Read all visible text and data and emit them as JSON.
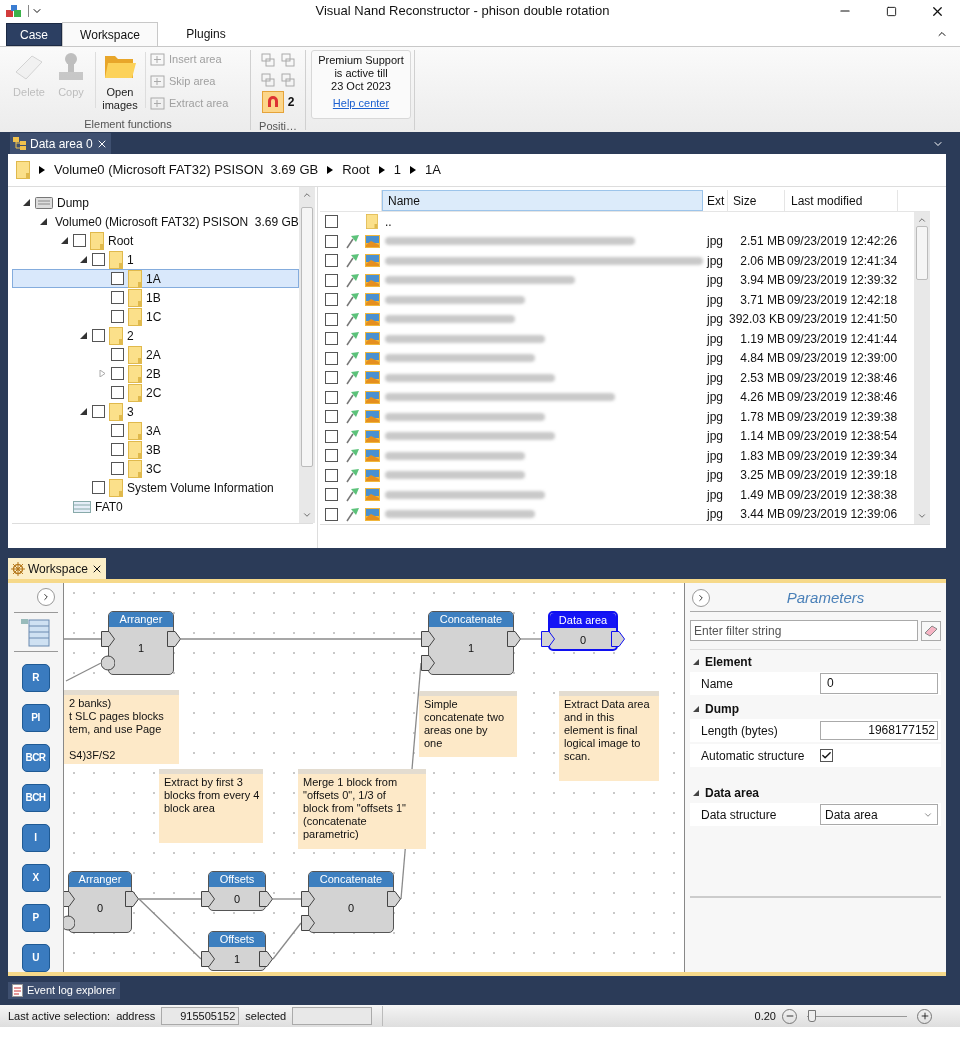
{
  "window": {
    "title": "Visual Nand Reconstructor - phison double rotation"
  },
  "ribbon": {
    "tabs": [
      {
        "label": "Case",
        "kind": "app",
        "selected": false
      },
      {
        "label": "Workspace",
        "kind": "tab",
        "selected": true
      },
      {
        "label": "Plugins",
        "kind": "tab",
        "selected": false
      }
    ],
    "element_functions": {
      "label": "Element functions",
      "large_buttons": [
        {
          "label": "Delete",
          "kind": "eraser",
          "disabled": true
        },
        {
          "label": "Copy",
          "kind": "stamp",
          "disabled": true
        },
        {
          "label": "Open images",
          "kind": "folder",
          "disabled": false
        }
      ],
      "small_buttons": [
        {
          "label": "Insert area",
          "disabled": true
        },
        {
          "label": "Skip area",
          "disabled": true
        },
        {
          "label": "Extract area",
          "disabled": true
        }
      ]
    },
    "position": {
      "label": "Positi…",
      "snap_on": true,
      "count": "2"
    },
    "support": {
      "lines": [
        "Premium Support",
        "is active till",
        "23 Oct 2023"
      ],
      "link": "Help center"
    }
  },
  "data_area_tab": {
    "title": "Data area 0"
  },
  "breadcrumb": [
    "Volume0 (Microsoft FAT32) PSISON  3.69 GB",
    "Root",
    "1",
    "1A"
  ],
  "tree": [
    {
      "label": "Dump",
      "kind": "drive",
      "expanded": true,
      "selected": false,
      "children": [
        {
          "label": "Volume0 (Microsoft FAT32) PSISON  3.69 GB",
          "kind": "disc",
          "expanded": true,
          "selected": false,
          "children": [
            {
              "label": "Root",
              "kind": "folder",
              "expanded": true,
              "checked": false,
              "selected": false,
              "children": [
                {
                  "label": "1",
                  "kind": "folder",
                  "expanded": true,
                  "checked": false,
                  "selected": false,
                  "children": [
                    {
                      "label": "1A",
                      "kind": "folder",
                      "checked": false,
                      "selected": true
                    },
                    {
                      "label": "1B",
                      "kind": "folder",
                      "checked": false,
                      "selected": false
                    },
                    {
                      "label": "1C",
                      "kind": "folder",
                      "checked": false,
                      "selected": false
                    }
                  ]
                },
                {
                  "label": "2",
                  "kind": "folder",
                  "expanded": true,
                  "checked": false,
                  "selected": false,
                  "children": [
                    {
                      "label": "2A",
                      "kind": "folder",
                      "checked": false,
                      "selected": false
                    },
                    {
                      "label": "2B",
                      "kind": "folder",
                      "expanded": false,
                      "checked": false,
                      "selected": false
                    },
                    {
                      "label": "2C",
                      "kind": "folder",
                      "checked": false,
                      "selected": false
                    }
                  ]
                },
                {
                  "label": "3",
                  "kind": "folder",
                  "expanded": true,
                  "checked": false,
                  "selected": false,
                  "children": [
                    {
                      "label": "3A",
                      "kind": "folder",
                      "checked": false,
                      "selected": false
                    },
                    {
                      "label": "3B",
                      "kind": "folder",
                      "checked": false,
                      "selected": false
                    },
                    {
                      "label": "3C",
                      "kind": "folder",
                      "checked": false,
                      "selected": false
                    }
                  ]
                },
                {
                  "label": "System Volume Information",
                  "kind": "folder",
                  "checked": false,
                  "selected": false
                }
              ]
            },
            {
              "label": "FAT0",
              "kind": "table",
              "selected": false
            }
          ]
        }
      ]
    }
  ],
  "files": {
    "columns": [
      "Name",
      "Ext",
      "Size",
      "Last modified"
    ],
    "rows": [
      {
        "kind": "parent",
        "name": "..",
        "checked": false
      },
      {
        "kind": "file",
        "ext": "jpg",
        "size": "2.51 MB",
        "modified": "09/23/2019 12:42:26",
        "checked": false
      },
      {
        "kind": "file",
        "ext": "jpg",
        "size": "2.06 MB",
        "modified": "09/23/2019 12:41:34",
        "checked": false
      },
      {
        "kind": "file",
        "ext": "jpg",
        "size": "3.94 MB",
        "modified": "09/23/2019 12:39:32",
        "checked": false
      },
      {
        "kind": "file",
        "ext": "jpg",
        "size": "3.71 MB",
        "modified": "09/23/2019 12:42:18",
        "checked": false
      },
      {
        "kind": "file",
        "ext": "jpg",
        "size": "392.03 KB",
        "modified": "09/23/2019 12:41:50",
        "checked": false
      },
      {
        "kind": "file",
        "ext": "jpg",
        "size": "1.19 MB",
        "modified": "09/23/2019 12:41:44",
        "checked": false
      },
      {
        "kind": "file",
        "ext": "jpg",
        "size": "4.84 MB",
        "modified": "09/23/2019 12:39:00",
        "checked": false
      },
      {
        "kind": "file",
        "ext": "jpg",
        "size": "2.53 MB",
        "modified": "09/23/2019 12:38:46",
        "checked": false
      },
      {
        "kind": "file",
        "ext": "jpg",
        "size": "4.26 MB",
        "modified": "09/23/2019 12:38:46",
        "checked": false
      },
      {
        "kind": "file",
        "ext": "jpg",
        "size": "1.78 MB",
        "modified": "09/23/2019 12:39:38",
        "checked": false
      },
      {
        "kind": "file",
        "ext": "jpg",
        "size": "1.14 MB",
        "modified": "09/23/2019 12:38:54",
        "checked": false
      },
      {
        "kind": "file",
        "ext": "jpg",
        "size": "1.83 MB",
        "modified": "09/23/2019 12:39:34",
        "checked": false
      },
      {
        "kind": "file",
        "ext": "jpg",
        "size": "3.25 MB",
        "modified": "09/23/2019 12:39:18",
        "checked": false
      },
      {
        "kind": "file",
        "ext": "jpg",
        "size": "1.49 MB",
        "modified": "09/23/2019 12:38:38",
        "checked": false
      },
      {
        "kind": "file",
        "ext": "jpg",
        "size": "3.44 MB",
        "modified": "09/23/2019 12:39:06",
        "checked": false
      }
    ]
  },
  "workspace": {
    "tab": "Workspace",
    "tools": [
      "R",
      "PI",
      "BCR",
      "BCH",
      "I",
      "X",
      "P",
      "U"
    ],
    "nodes": [
      {
        "title": "Arranger",
        "value": "1",
        "selected": false
      },
      {
        "title": "Concatenate",
        "value": "1",
        "selected": false
      },
      {
        "title": "Data area",
        "value": "0",
        "selected": true
      },
      {
        "title": "Arranger",
        "value": "0",
        "selected": false
      },
      {
        "title": "Offsets",
        "value": "0",
        "selected": false
      },
      {
        "title": "Offsets",
        "value": "1",
        "selected": false
      },
      {
        "title": "Concatenate",
        "value": "0",
        "selected": false
      }
    ],
    "notes": [
      "2 banks)\nt SLC pages blocks\ntem, and use Page\n\nS4)3F/S2",
      "Extract by first 3\nblocks from every 4\nblock area",
      "Merge 1 block from\n\"offsets 0\", 1/3 of\nblock from \"offsets 1\"\n(concatenate\nparametric)",
      "Simple\nconcatenate two\nareas one by\none",
      "Extract Data area\nand in this\nelement is final\nlogical image to\nscan."
    ]
  },
  "parameters": {
    "title": "Parameters",
    "filter_placeholder": "Enter filter string",
    "groups": [
      {
        "name": "Element",
        "expanded": true,
        "props": [
          {
            "kind": "text",
            "label": "Name",
            "value": "0"
          }
        ]
      },
      {
        "name": "Dump",
        "expanded": true,
        "props": [
          {
            "kind": "number",
            "label": "Length (bytes)",
            "value": "1968177152"
          },
          {
            "kind": "check",
            "label": "Automatic structure",
            "checked": true
          }
        ]
      },
      {
        "name": "Data area",
        "expanded": true,
        "props": [
          {
            "kind": "select",
            "label": "Data structure",
            "value": "Data area"
          }
        ]
      }
    ]
  },
  "event_log_tab": "Event log explorer",
  "status": {
    "label": "Last active selection:",
    "address_label": "address",
    "address": "915505152",
    "selected_label": "selected",
    "zoom": "0.20",
    "zoom_slider": {
      "level": 0.05
    }
  }
}
